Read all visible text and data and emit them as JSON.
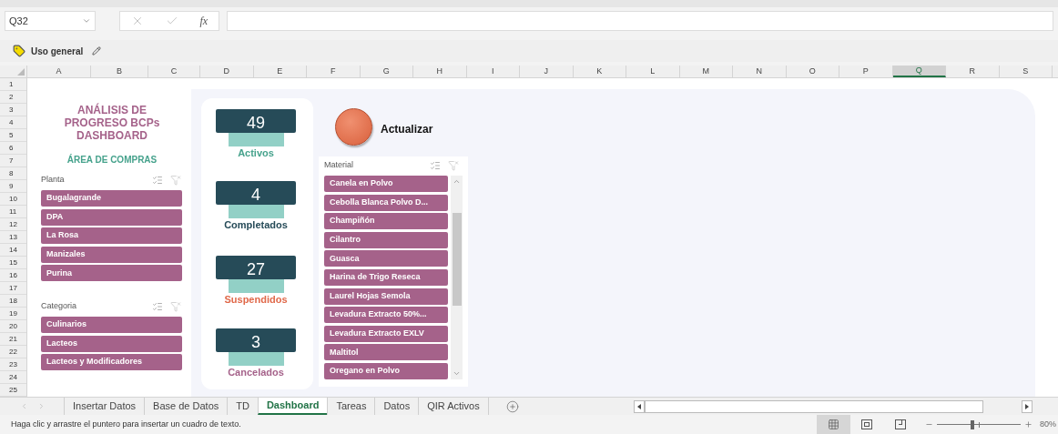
{
  "formula_bar": {
    "name_box": "Q32",
    "function_label": "fx"
  },
  "sensitivity_label": "Uso general",
  "columns": [
    {
      "label": "A",
      "selected": false
    },
    {
      "label": "B",
      "selected": false
    },
    {
      "label": "C",
      "selected": false
    },
    {
      "label": "D",
      "selected": false
    },
    {
      "label": "E",
      "selected": false
    },
    {
      "label": "F",
      "selected": false
    },
    {
      "label": "G",
      "selected": false
    },
    {
      "label": "H",
      "selected": false
    },
    {
      "label": "I",
      "selected": false
    },
    {
      "label": "J",
      "selected": false
    },
    {
      "label": "K",
      "selected": false
    },
    {
      "label": "L",
      "selected": false
    },
    {
      "label": "M",
      "selected": false
    },
    {
      "label": "N",
      "selected": false
    },
    {
      "label": "O",
      "selected": false
    },
    {
      "label": "P",
      "selected": false
    },
    {
      "label": "Q",
      "selected": true
    },
    {
      "label": "R",
      "selected": false
    },
    {
      "label": "S",
      "selected": false
    }
  ],
  "rows": [
    "1",
    "2",
    "3",
    "4",
    "5",
    "6",
    "7",
    "8",
    "9",
    "10",
    "11",
    "12",
    "13",
    "14",
    "15",
    "16",
    "17",
    "18",
    "19",
    "20",
    "21",
    "22",
    "23",
    "24",
    "25"
  ],
  "dashboard": {
    "title": "ANÁLISIS DE\nPROGRESO BCPs\nDASHBOARD",
    "subtitle": "ÁREA DE COMPRAS",
    "slicers": [
      {
        "title": "Planta",
        "items": [
          {
            "label": "Bugalagrande",
            "selected": true
          },
          {
            "label": "DPA",
            "selected": true
          },
          {
            "label": "La Rosa",
            "selected": true
          },
          {
            "label": "Manizales",
            "selected": true
          },
          {
            "label": "Purina",
            "selected": true
          }
        ]
      },
      {
        "title": "Categoria",
        "items": [
          {
            "label": "Culinarios",
            "selected": true
          },
          {
            "label": "Lacteos",
            "selected": true
          },
          {
            "label": "Lacteos y Modificadores",
            "selected": true
          }
        ]
      },
      {
        "title": "Material",
        "items": [
          {
            "label": "Canela en Polvo",
            "selected": true
          },
          {
            "label": "Cebolla Blanca Polvo D...",
            "selected": true
          },
          {
            "label": "Champiñón",
            "selected": true
          },
          {
            "label": "Cilantro",
            "selected": true
          },
          {
            "label": "Guasca",
            "selected": true
          },
          {
            "label": "Harina de Trigo Reseca",
            "selected": true
          },
          {
            "label": "Laurel Hojas Semola",
            "selected": true
          },
          {
            "label": "Levadura Extracto 50%...",
            "selected": true
          },
          {
            "label": "Levadura Extracto EXLV",
            "selected": true
          },
          {
            "label": "Maltitol",
            "selected": true
          },
          {
            "label": "Oregano en Polvo",
            "selected": true
          }
        ]
      }
    ],
    "kpis": [
      {
        "value": "49",
        "label": "Activos",
        "color": "#46a28c"
      },
      {
        "value": "4",
        "label": "Completados",
        "color": "#264b58"
      },
      {
        "value": "27",
        "label": "Suspendidos",
        "color": "#e0694a"
      },
      {
        "value": "3",
        "label": "Cancelados",
        "color": "#a5628a"
      }
    ],
    "refresh_button": {
      "label": "Actualizar"
    }
  },
  "sheet_tabs": [
    {
      "label": "Insertar Datos",
      "selected": false
    },
    {
      "label": "Base de Datos",
      "selected": false
    },
    {
      "label": "TD",
      "selected": false
    },
    {
      "label": "Dashboard",
      "selected": true
    },
    {
      "label": "Tareas",
      "selected": false
    },
    {
      "label": "Datos",
      "selected": false
    },
    {
      "label": "QIR Activos",
      "selected": false
    }
  ],
  "status_bar": {
    "message": "Haga clic y arrastre el puntero para insertar un cuadro de texto.",
    "views": [
      {
        "kind": "normal",
        "selected": true
      },
      {
        "kind": "page_layout",
        "selected": false
      },
      {
        "kind": "page_break",
        "selected": false
      }
    ],
    "zoom": {
      "level": 0.42,
      "label": "80%"
    }
  }
}
